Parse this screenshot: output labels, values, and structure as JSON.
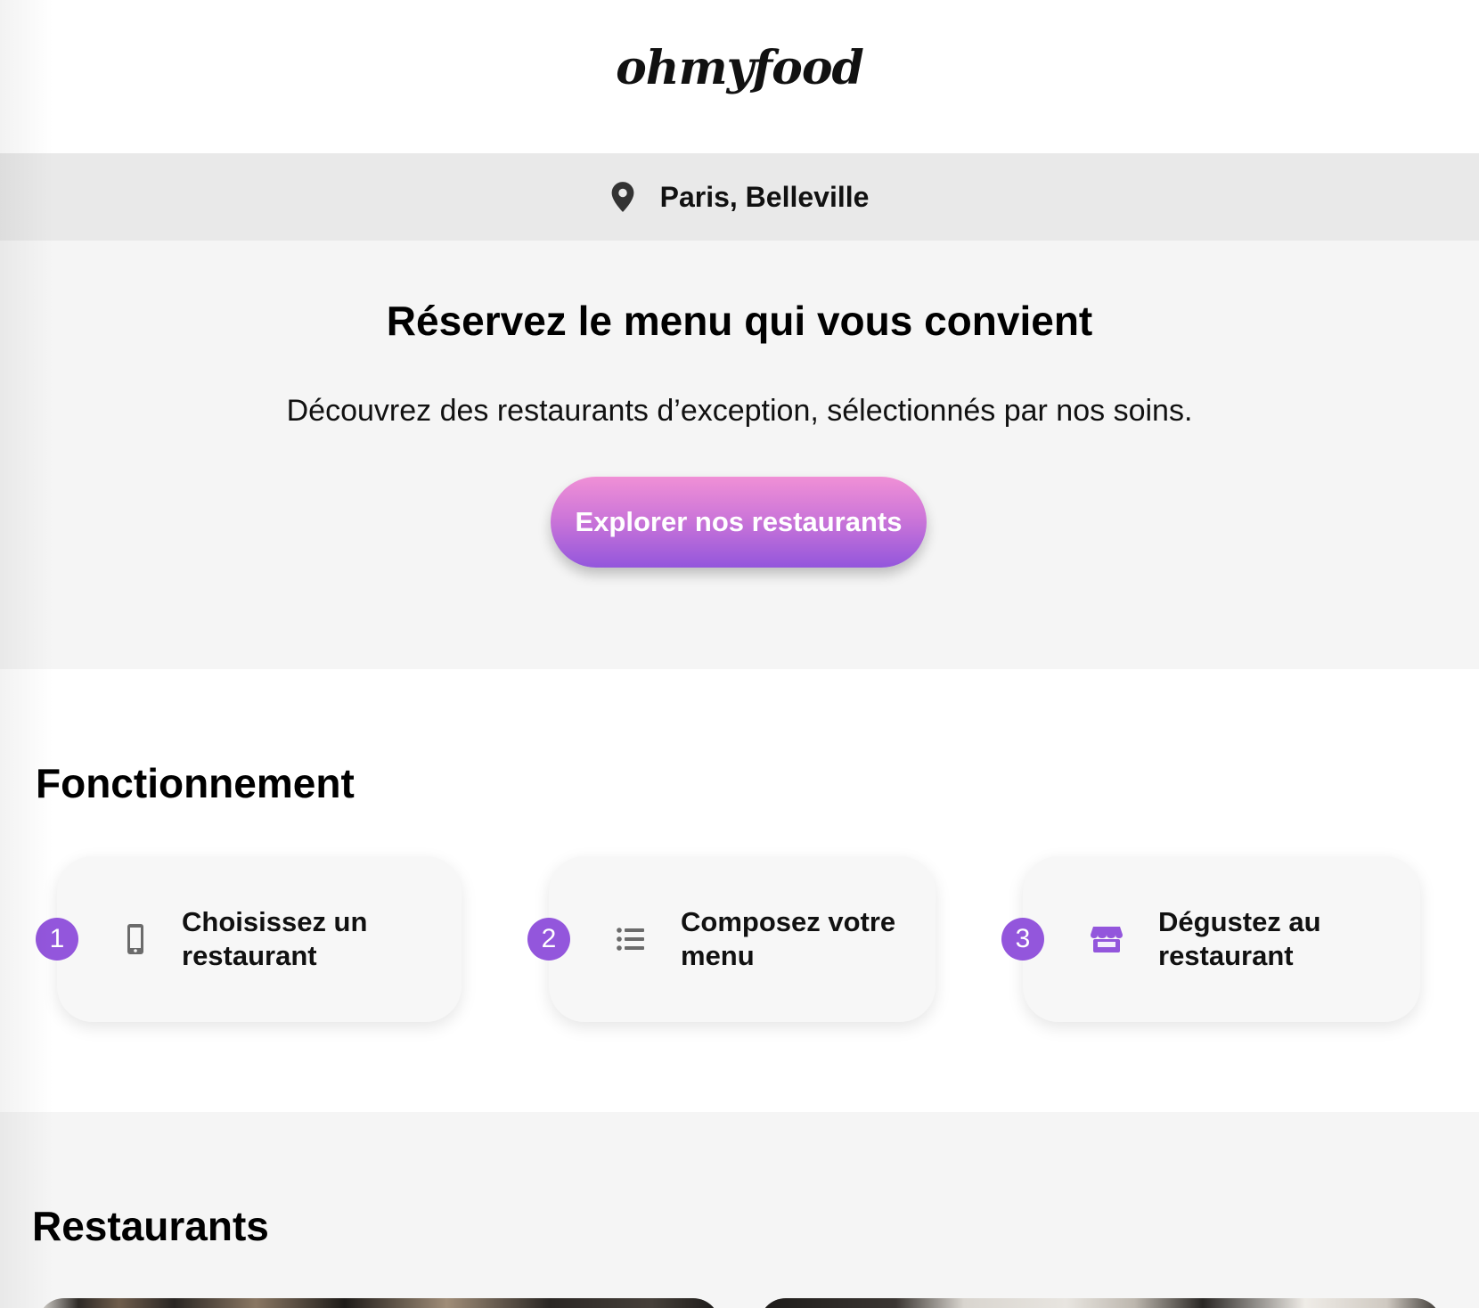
{
  "header": {
    "logo_text": "ohmyfood"
  },
  "location": {
    "icon": "map-pin-icon",
    "text": "Paris, Belleville"
  },
  "hero": {
    "title": "Réservez le menu qui vous convient",
    "subtitle": "Découvrez des restaurants d’exception, sélectionnés par nos soins.",
    "cta_label": "Explorer nos restaurants"
  },
  "how_it_works": {
    "title": "Fonctionnement",
    "steps": [
      {
        "number": "1",
        "icon": "mobile-phone-icon",
        "line1": "Choisissez un",
        "line2": "restaurant"
      },
      {
        "number": "2",
        "icon": "list-icon",
        "line1": "Composez votre",
        "line2": "menu"
      },
      {
        "number": "3",
        "icon": "store-icon",
        "line1": "Dégustez au",
        "line2": "restaurant"
      }
    ]
  },
  "restaurants": {
    "title": "Restaurants"
  },
  "colors": {
    "accent": "#9356dc",
    "cta_gradient_top": "#f090d6",
    "cta_gradient_bottom": "#9356dc",
    "location_bar_bg": "#e9e9e9",
    "section_bg": "#f5f5f5"
  }
}
